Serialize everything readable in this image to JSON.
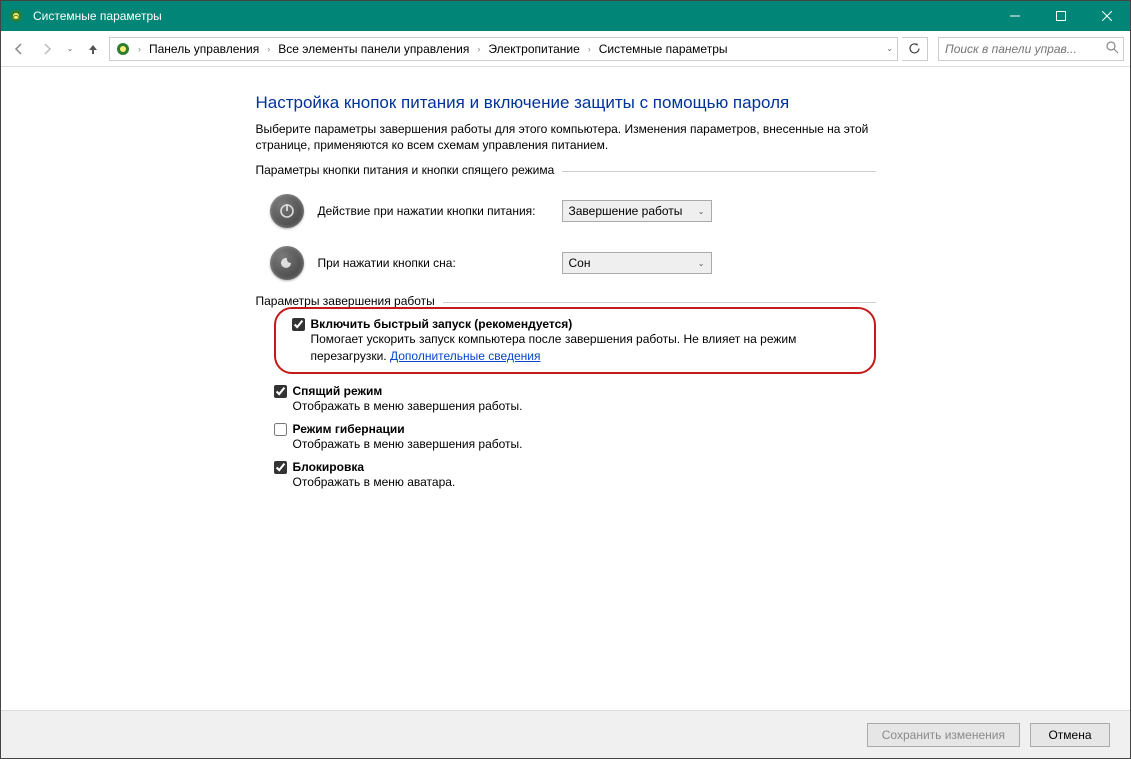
{
  "window": {
    "title": "Системные параметры"
  },
  "breadcrumbs": {
    "b0": "Панель управления",
    "b1": "Все элементы панели управления",
    "b2": "Электропитание",
    "b3": "Системные параметры"
  },
  "search": {
    "placeholder": "Поиск в панели управ..."
  },
  "page": {
    "title": "Настройка кнопок питания и включение защиты с помощью пароля",
    "desc": "Выберите параметры завершения работы для этого компьютера. Изменения параметров, внесенные на этой странице, применяются ко всем схемам управления питанием."
  },
  "group1": {
    "legend": "Параметры кнопки питания и кнопки спящего режима",
    "row1_label": "Действие при нажатии кнопки питания:",
    "row1_value": "Завершение работы",
    "row2_label": "При нажатии кнопки сна:",
    "row2_value": "Сон"
  },
  "group2": {
    "legend": "Параметры завершения работы",
    "opt1_title": "Включить быстрый запуск (рекомендуется)",
    "opt1_desc1": "Помогает ускорить запуск компьютера после завершения работы. Не влияет на режим перезагрузки. ",
    "opt1_link": "Дополнительные сведения",
    "opt2_title": "Спящий режим",
    "opt2_desc": "Отображать в меню завершения работы.",
    "opt3_title": "Режим гибернации",
    "opt3_desc": "Отображать в меню завершения работы.",
    "opt4_title": "Блокировка",
    "opt4_desc": "Отображать в меню аватара."
  },
  "footer": {
    "save": "Сохранить изменения",
    "cancel": "Отмена"
  }
}
